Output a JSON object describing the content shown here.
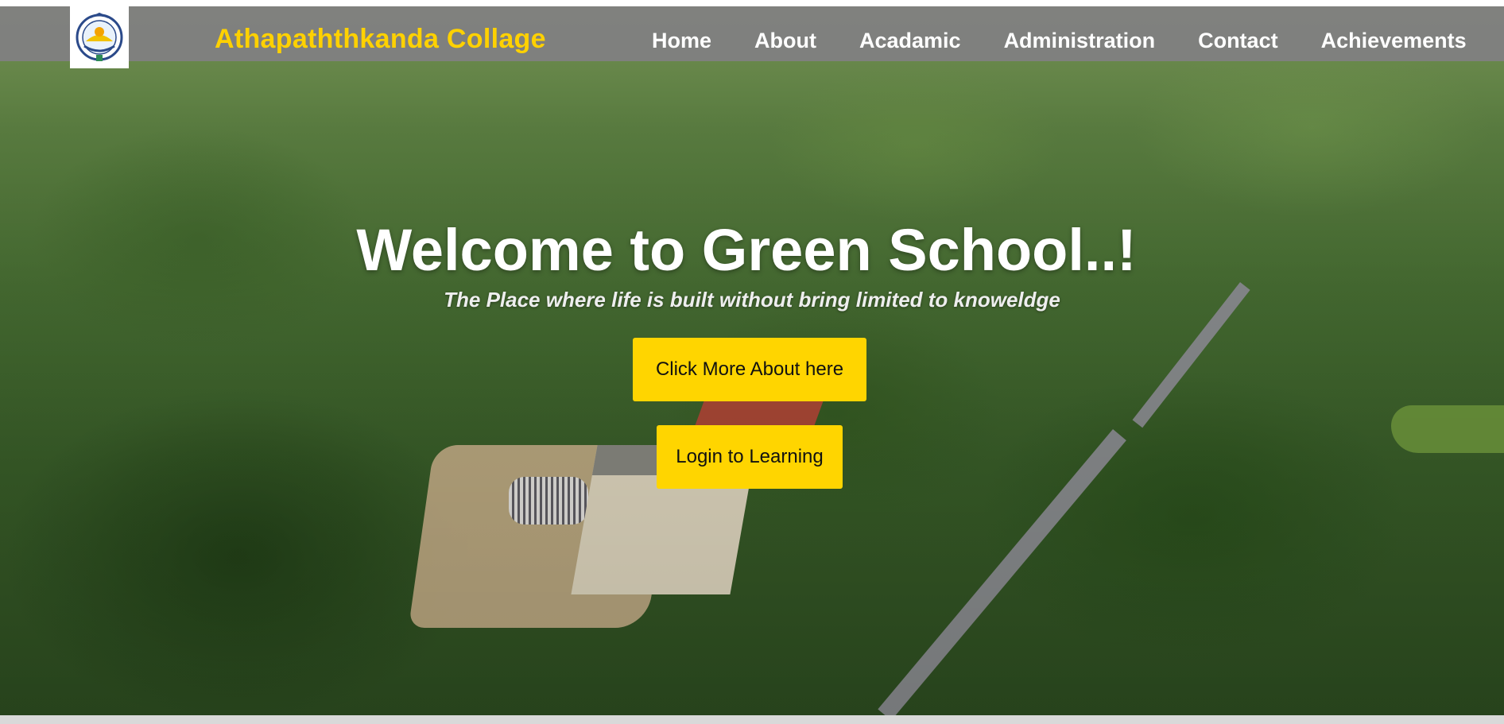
{
  "header": {
    "brand": "Athapaththkanda Collage",
    "logo_icon": "school-crest-icon"
  },
  "nav": {
    "items": [
      {
        "label": "Home"
      },
      {
        "label": "About"
      },
      {
        "label": "Acadamic"
      },
      {
        "label": "Administration"
      },
      {
        "label": "Contact"
      },
      {
        "label": "Achievements"
      }
    ]
  },
  "hero": {
    "title": "Welcome to Green School..!",
    "subtitle": "The Place where life is built without bring limited to knoweldge",
    "about_button": "Click More About here",
    "login_button": "Login to Learning"
  },
  "colors": {
    "accent": "#ffd500",
    "brand_text": "#ffd100",
    "nav_bar": "#808080"
  }
}
